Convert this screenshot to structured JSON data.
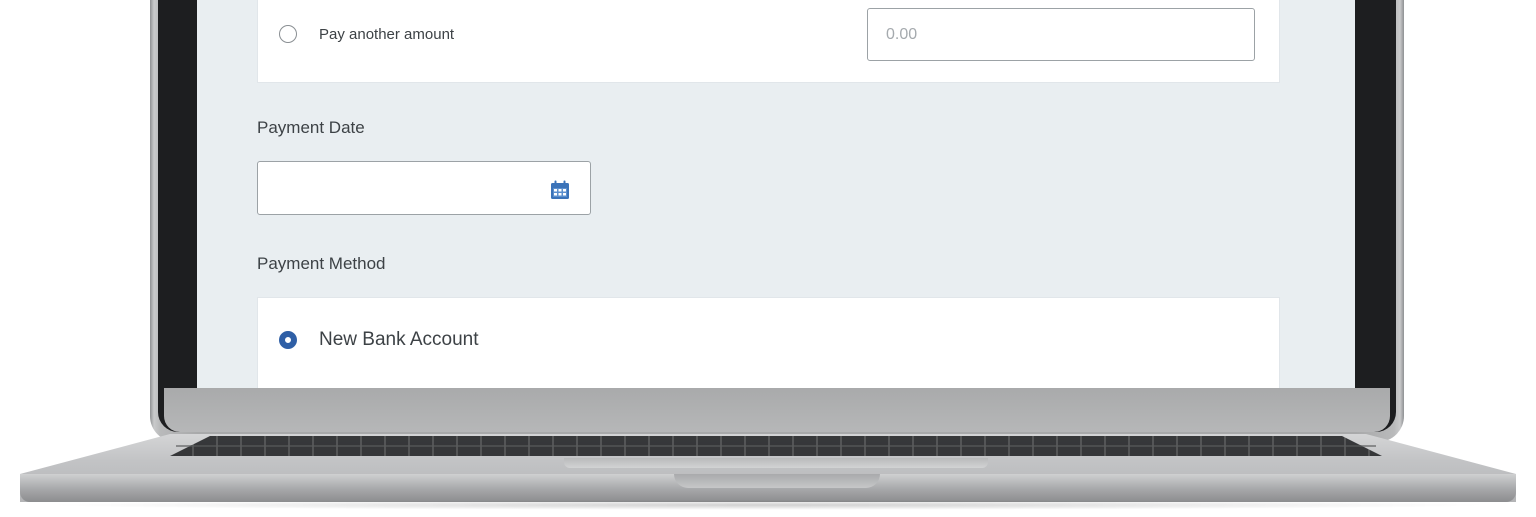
{
  "form": {
    "pay_another": {
      "label": "Pay another amount",
      "amount_placeholder": "0.00",
      "selected": false
    },
    "payment_date": {
      "label": "Payment Date",
      "value": "",
      "icon": "calendar-icon"
    },
    "payment_method": {
      "label": "Payment Method",
      "options": [
        {
          "label": "New Bank Account",
          "selected": true
        }
      ]
    }
  },
  "colors": {
    "screen_background": "#e9eef1",
    "radio_selected": "#2f5fa6",
    "calendar_icon": "#3b73b9",
    "text": "#3d4246"
  }
}
